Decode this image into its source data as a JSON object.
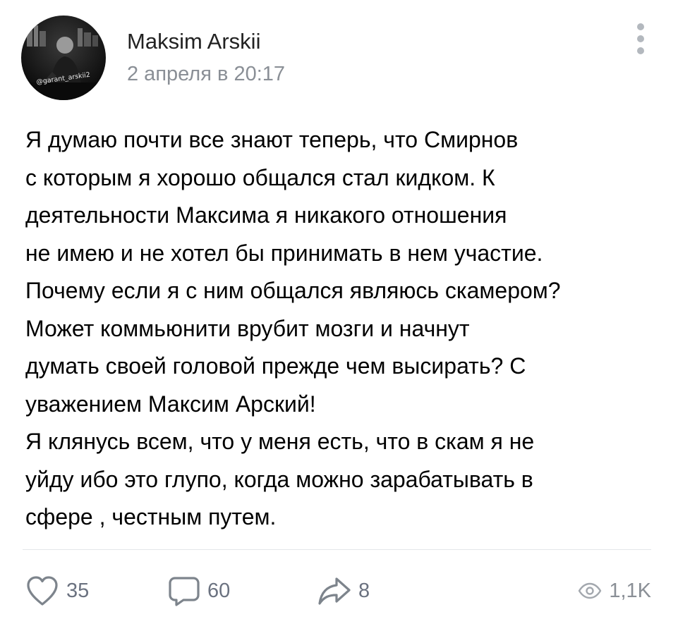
{
  "post": {
    "author": "Maksim Arskii",
    "date": "2 апреля в 20:17",
    "avatar_watermark": "@garant_arskii2",
    "text_lines": [
      "Я думаю почти все знают теперь, что Смирнов",
      "с которым я хорошо общался стал кидком. К",
      "деятельности Максима я никакого отношения",
      "не имею и не хотел бы принимать в нем участие.",
      "Почему если я с ним общался являюсь скамером?",
      "Может коммьюнити врубит мозги и начнут",
      "думать своей головой прежде чем высирать? С",
      "уважением Максим Арский!",
      "Я клянусь всем, что у меня есть, что в скам я не",
      "уйду ибо это глупо, когда можно зарабатывать в",
      "сфере , честным путем."
    ]
  },
  "actions": {
    "likes": "35",
    "comments": "60",
    "shares": "8",
    "views": "1,1K"
  },
  "icons": {
    "menu": "more-vertical-icon",
    "like": "heart-icon",
    "comment": "comment-bubble-icon",
    "share": "share-arrow-icon",
    "views": "eye-icon"
  },
  "colors": {
    "icon_gray": "#7d848c",
    "secondary_text": "#8a8f96",
    "divider": "#e4e6e9"
  }
}
